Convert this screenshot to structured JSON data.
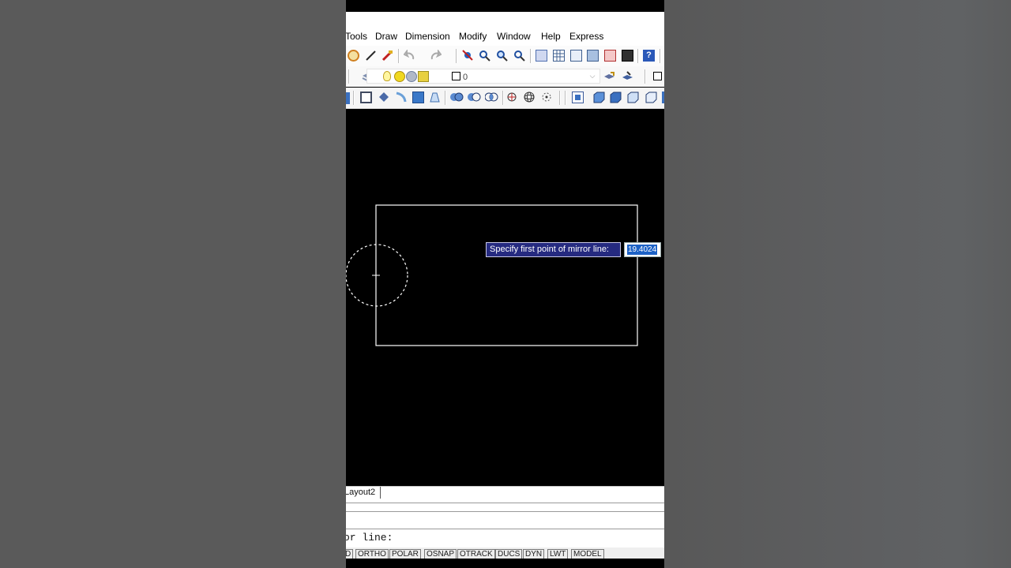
{
  "menu": {
    "items": [
      "Tools",
      "Draw",
      "Dimension",
      "Modify",
      "Window",
      "Help",
      "Express"
    ]
  },
  "layers": {
    "current_layer": "0"
  },
  "tabs": {
    "layout_tab": "Layout2"
  },
  "command": {
    "prompt_text": "or line:"
  },
  "status": {
    "buttons": [
      "D",
      "ORTHO",
      "POLAR",
      "OSNAP",
      "OTRACK",
      "DUCS",
      "DYN",
      "LWT",
      "MODEL"
    ]
  },
  "dynamic_input": {
    "prompt": "Specify first point of mirror line:",
    "value": "19.4024"
  },
  "colors": {
    "canvas": "#000000",
    "tooltip_bg": "#252a80",
    "selection_highlight": "#1d62c6",
    "geometry": "#ffffff"
  },
  "icons": {
    "toolbar1": [
      "hatch-icon",
      "pencil-icon",
      "match-properties-icon",
      "undo-icon",
      "redo-icon",
      "pan-icon",
      "zoom-realtime-icon",
      "zoom-window-icon",
      "zoom-previous-icon",
      "properties-icon",
      "design-center-icon",
      "tool-palettes-icon",
      "sheet-set-icon",
      "markup-icon",
      "calculator-icon",
      "help-icon"
    ],
    "toolbar2": [
      "layer-manager-icon",
      "lightbulb-icon",
      "sun-icon",
      "freeze-icon",
      "lock-icon",
      "color-swatch-icon",
      "make-current-icon",
      "layer-previous-icon"
    ],
    "toolbar3": [
      "extrude-icon",
      "revolve-icon",
      "sweep-icon",
      "loft-icon",
      "presspull-icon",
      "union-icon",
      "subtract-icon",
      "intersect-icon",
      "3d-orbit-icon",
      "3d-free-orbit-icon",
      "3d-continuous-orbit-icon",
      "top-view-icon",
      "front-view-icon",
      "right-view-icon",
      "iso-view-icon",
      "ucs-icon"
    ]
  }
}
